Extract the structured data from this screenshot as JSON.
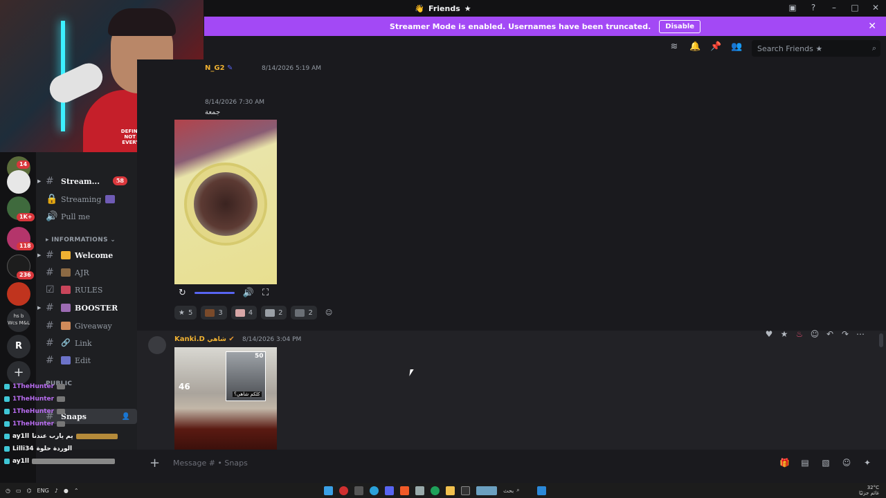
{
  "window": {
    "title": "Friends",
    "title_glyph": "★"
  },
  "banner": {
    "text": "Streamer Mode is enabled. Usernames have been truncated.",
    "disable_label": "Disable"
  },
  "servers": {
    "badges": [
      "14",
      "1K+",
      "118",
      "236"
    ],
    "letter": "R",
    "abbrev_1": "hs b",
    "abbrev_2": "Wcs M&L"
  },
  "channels": [
    {
      "label": "Stream...",
      "badge": "58",
      "bold": true,
      "icon": "hash",
      "emo_color": ""
    },
    {
      "label": "Streaming",
      "bold": false,
      "icon": "lock",
      "emo_color": "#6f5bb5"
    },
    {
      "label": "Pull me",
      "bold": false,
      "icon": "speaker",
      "emo_color": ""
    },
    {
      "label": "Welcome",
      "bold": true,
      "icon": "hash",
      "emo_color": "#f0b232"
    },
    {
      "label": "AJR",
      "bold": false,
      "icon": "hash",
      "emo_color": "#8c6a44"
    },
    {
      "label": "RULES",
      "bold": false,
      "icon": "rules",
      "emo_color": "#c8455a"
    },
    {
      "label": "BOOSTER",
      "bold": true,
      "icon": "hash",
      "emo_color": "#9c6bb3"
    },
    {
      "label": "Giveaway",
      "bold": false,
      "icon": "hash",
      "emo_color": "#cf8a5a"
    },
    {
      "label": "Link",
      "bold": false,
      "icon": "link",
      "emo_color": ""
    },
    {
      "label": "Edit",
      "bold": false,
      "icon": "hash",
      "emo_color": "#6c73c9"
    }
  ],
  "category": {
    "label": "INFORMATIONS"
  },
  "public_category": "PUBLIC",
  "snaps_channel": "Snaps",
  "chat_overlay": [
    {
      "user": "1TheHunter",
      "color": "#b86cf0",
      "sq": "#3fc7d6"
    },
    {
      "user": "1TheHunter",
      "color": "#b86cf0",
      "sq": "#3fc7d6"
    },
    {
      "user": "1TheHunter",
      "color": "#b86cf0",
      "sq": "#3fc7d6"
    },
    {
      "user": "1TheHunter",
      "color": "#b86cf0",
      "sq": "#3fc7d6"
    },
    {
      "user": "ay1ll",
      "color": "#ffffff",
      "sq": "#3fc7d6",
      "text": "يم يارب عندنا"
    },
    {
      "user": "Lilli34",
      "color": "#ffffff",
      "sq": "#3fc7d6",
      "text": "الوردة حلوة"
    },
    {
      "user": "ay1ll",
      "color": "#ffffff",
      "sq": "#3fc7d6"
    }
  ],
  "cam": {
    "shirt_text": "DEFINITELY NOT FOR EVERYONE"
  },
  "toolbar": {
    "search_placeholder": "Search Friends ★"
  },
  "messages": {
    "m1": {
      "user": "N_G2",
      "time": "8/14/2026 5:19 AM"
    },
    "m2": {
      "time": "8/14/2026 7:30 AM",
      "text": "جمعة"
    },
    "reactions": [
      {
        "count": "5",
        "color": "#e0e1e5"
      },
      {
        "count": "3",
        "color": "#7a4a2a"
      },
      {
        "count": "4",
        "color": "#d7a6a6"
      },
      {
        "count": "2",
        "color": "#9aa0a6"
      },
      {
        "count": "2",
        "color": "#6a6f75"
      }
    ],
    "m3": {
      "user": "Kanki.D",
      "tag": "شاهي",
      "time": "8/14/2026 3:04 PM"
    },
    "img2": {
      "n46": "46",
      "n50": "50",
      "caption": "كلكم شاهي؟"
    }
  },
  "composer": {
    "placeholder": "Message # • Snaps"
  },
  "taskbar": {
    "lang": "ENG",
    "weather": "32°C",
    "weather_label": "غائم جزئيًا",
    "search": "بحث"
  },
  "colors": {
    "accent": "#a349f5",
    "blurple": "#5865f2",
    "unread": "#da373c",
    "username": "#f0b232"
  }
}
